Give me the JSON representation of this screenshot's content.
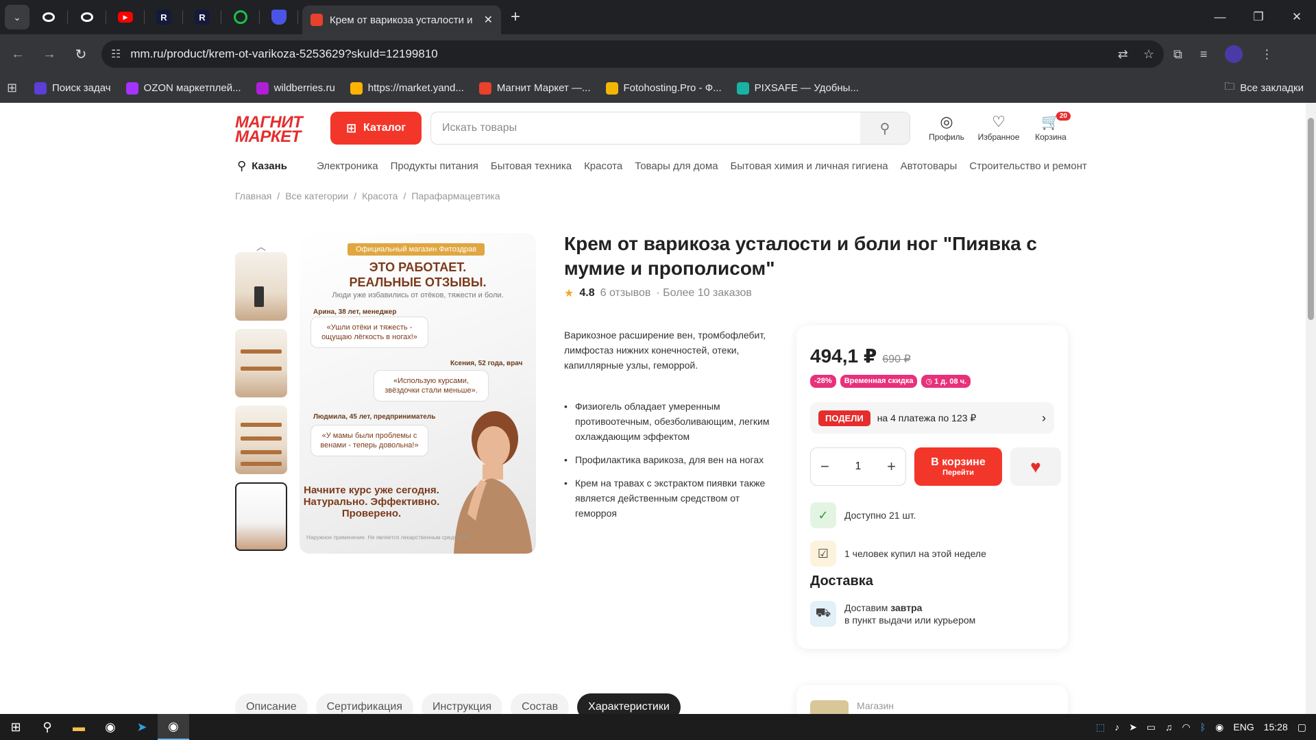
{
  "browser": {
    "active_tab_title": "Крем от варикоза усталости и",
    "url": "mm.ru/product/krem-ot-varikoza-5253629?skuId=12199810",
    "bookmarks": [
      {
        "label": "Поиск задач",
        "color": "#5b3fd6"
      },
      {
        "label": "OZON маркетплей...",
        "color": "#a533ff"
      },
      {
        "label": "wildberries.ru",
        "color": "#b01fd6"
      },
      {
        "label": "https://market.yand...",
        "color": "#ffb300"
      },
      {
        "label": "Магнит Маркет —...",
        "color": "#e8412c"
      },
      {
        "label": "Fotohosting.Pro - Ф...",
        "color": "#f2b705"
      },
      {
        "label": "PIXSAFE — Удобны...",
        "color": "#18b3a5"
      }
    ],
    "all_bookmarks": "Все закладки"
  },
  "header": {
    "logo_line1": "МАГНИТ",
    "logo_line2": "МАРКЕТ",
    "catalog_label": "Каталог",
    "search_placeholder": "Искать товары",
    "profile": "Профиль",
    "favorites": "Избранное",
    "cart": "Корзина",
    "cart_count": "20"
  },
  "nav": {
    "city": "Казань",
    "categories": [
      "Электроника",
      "Продукты питания",
      "Бытовая техника",
      "Красота",
      "Товары для дома",
      "Бытовая химия и личная гигиена",
      "Автотовары",
      "Строительство и ремонт"
    ]
  },
  "breadcrumbs": [
    "Главная",
    "Все категории",
    "Красота",
    "Парафармацевтика"
  ],
  "gallery": {
    "badge": "Официальный магазин Фитоздрав",
    "headline1": "ЭТО РАБОТАЕТ.",
    "headline2": "РЕАЛЬНЫЕ ОТЗЫВЫ.",
    "subline": "Люди уже избавились от отёков, тяжести и боли.",
    "name1": "Арина, 38 лет, менеджер",
    "quote1": "«Ушли отёки и тяжесть - ощущаю лёгкость в ногах!»",
    "name2": "Ксения, 52 года, врач",
    "quote2": "«Использую курсами, звёздочки стали меньше».",
    "name3": "Людмила, 45 лет, предприниматель",
    "quote3": "«У мамы были проблемы с венами - теперь довольна!»",
    "cta1": "Начните курс уже сегодня.",
    "cta2": "Натурально. Эффективно.",
    "cta3": "Проверено.",
    "footnote": "Наружное применение. Не является лекарственным средством"
  },
  "product": {
    "title": "Крем от варикоза усталости и боли ног \"Пиявка с мумие и прополисом\"",
    "rating": "4.8",
    "reviews": "6 отзывов",
    "orders": "· Более 10 заказов",
    "description": "Варикозное расширение вен, тромбофлебит, лимфостаз нижних конечностей, отеки, капиллярные узлы, геморрой.",
    "bullets": [
      "Физиогель обладает умеренным противоотечным, обезболивающим, легким охлаждающим эффектом",
      "Профилактика варикоза, для вен на ногах",
      "Крем на травах с экстрактом пиявки также является действенным средством от геморроя"
    ]
  },
  "buy": {
    "price": "494,1 ₽",
    "old_price": "690 ₽",
    "discount": "-28%",
    "temp_discount": "Временная скидка",
    "timer": "1 д. 08 ч.",
    "split_logo": "ПОДЕЛИ",
    "split_text": "на 4 платежа по 123 ₽",
    "qty": "1",
    "in_cart": "В корзине",
    "go": "Перейти",
    "available": "Доступно 21 шт.",
    "bought": "1 человек купил на этой неделе",
    "delivery_title": "Доставка",
    "deliver_prefix": "Доставим ",
    "deliver_when": "завтра",
    "deliver_where": "в пункт выдачи или курьером"
  },
  "tabs": [
    "Описание",
    "Сертификация",
    "Инструкция",
    "Состав",
    "Характеристики"
  ],
  "store": {
    "label": "Магазин"
  },
  "taskbar": {
    "lang": "ENG",
    "time": "15:28"
  }
}
